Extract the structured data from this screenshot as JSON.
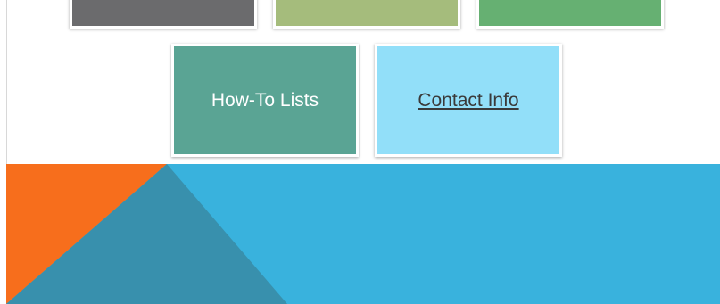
{
  "tiles": {
    "top_row": [
      {
        "color": "#6b6b6d"
      },
      {
        "color": "#a5bc7c"
      },
      {
        "color": "#66b072"
      }
    ],
    "how_to": {
      "label": "How-To Lists",
      "color": "#5aa494"
    },
    "contact": {
      "label": "Contact Info",
      "color": "#92dff9"
    }
  },
  "banner": {
    "background": "#39b2dd",
    "orange": "#f76e1c",
    "dark_teal": "#3890ad"
  }
}
